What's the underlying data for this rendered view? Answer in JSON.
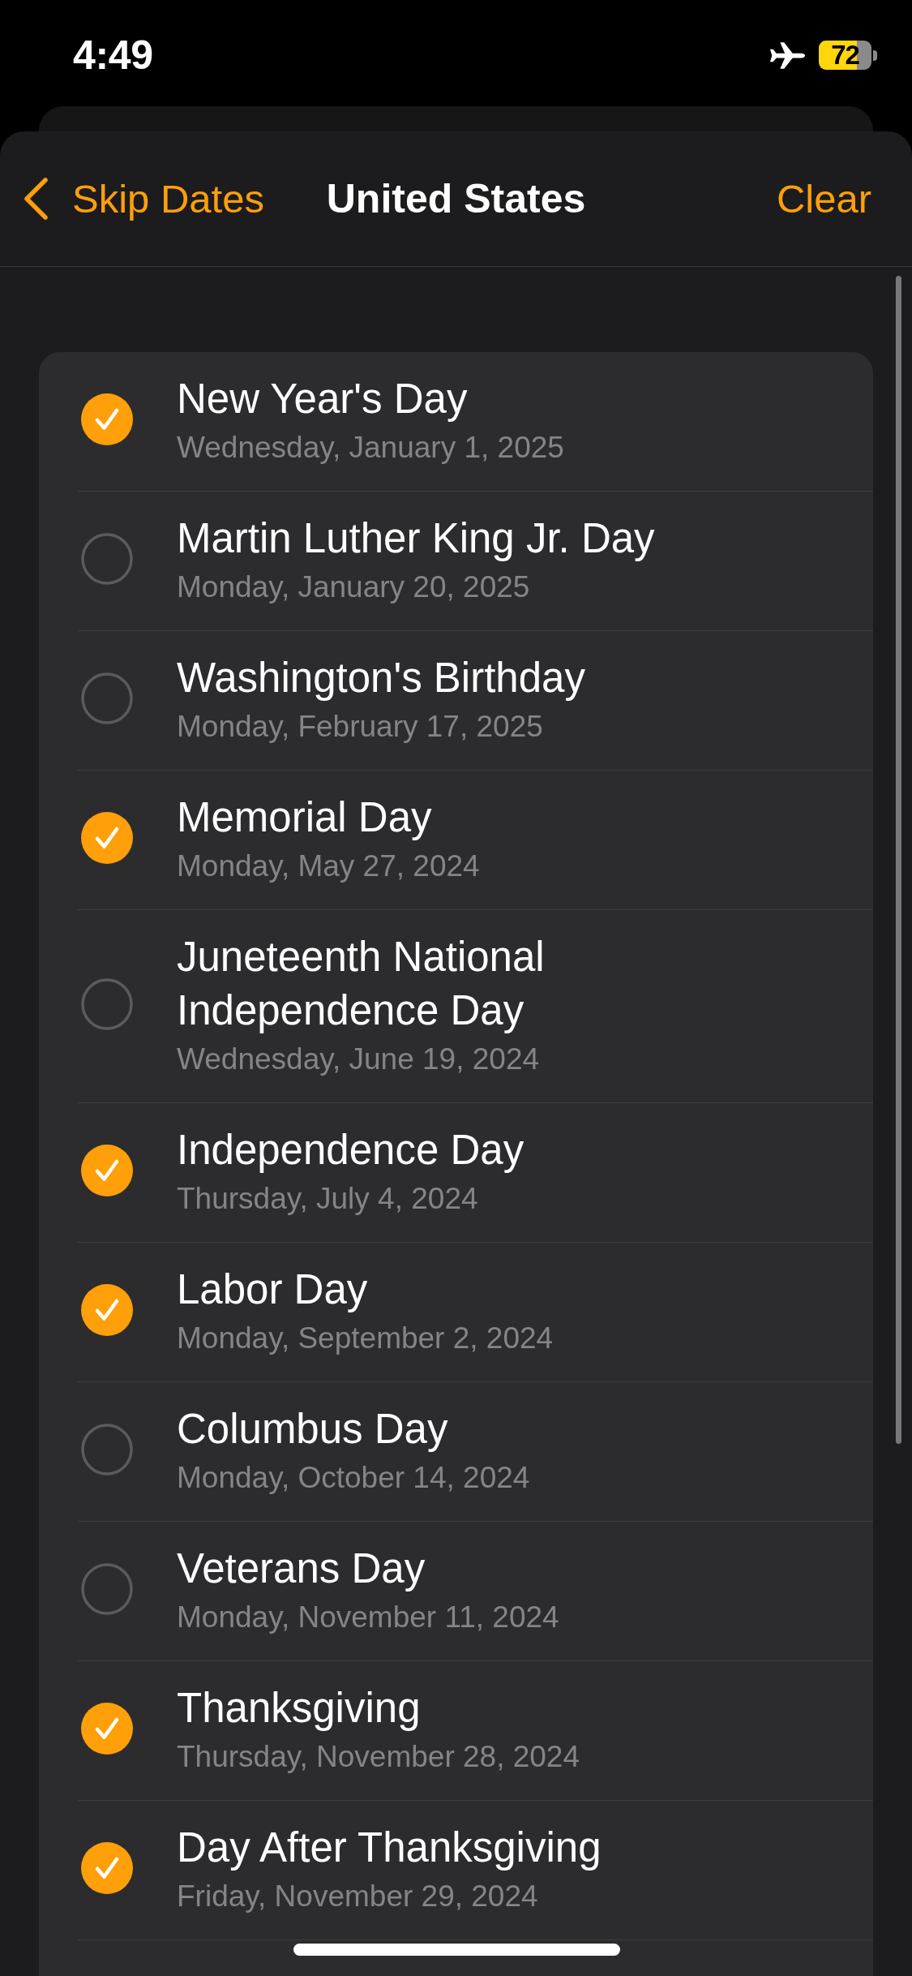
{
  "status_bar": {
    "time": "4:49",
    "battery": "72"
  },
  "nav": {
    "back": "Skip Dates",
    "title": "United States",
    "action": "Clear"
  },
  "holidays": [
    {
      "name": "New Year's Day",
      "date": "Wednesday, January 1, 2025",
      "checked": true
    },
    {
      "name": "Martin Luther King Jr. Day",
      "date": "Monday, January 20, 2025",
      "checked": false
    },
    {
      "name": "Washington's Birthday",
      "date": "Monday, February 17, 2025",
      "checked": false
    },
    {
      "name": "Memorial Day",
      "date": "Monday, May 27, 2024",
      "checked": true
    },
    {
      "name": "Juneteenth National Independence Day",
      "date": "Wednesday, June 19, 2024",
      "checked": false
    },
    {
      "name": "Independence Day",
      "date": "Thursday, July 4, 2024",
      "checked": true
    },
    {
      "name": "Labor Day",
      "date": "Monday, September 2, 2024",
      "checked": true
    },
    {
      "name": "Columbus Day",
      "date": "Monday, October 14, 2024",
      "checked": false
    },
    {
      "name": "Veterans Day",
      "date": "Monday, November 11, 2024",
      "checked": false
    },
    {
      "name": "Thanksgiving",
      "date": "Thursday, November 28, 2024",
      "checked": true
    },
    {
      "name": "Day After Thanksgiving",
      "date": "Friday, November 29, 2024",
      "checked": true
    }
  ]
}
